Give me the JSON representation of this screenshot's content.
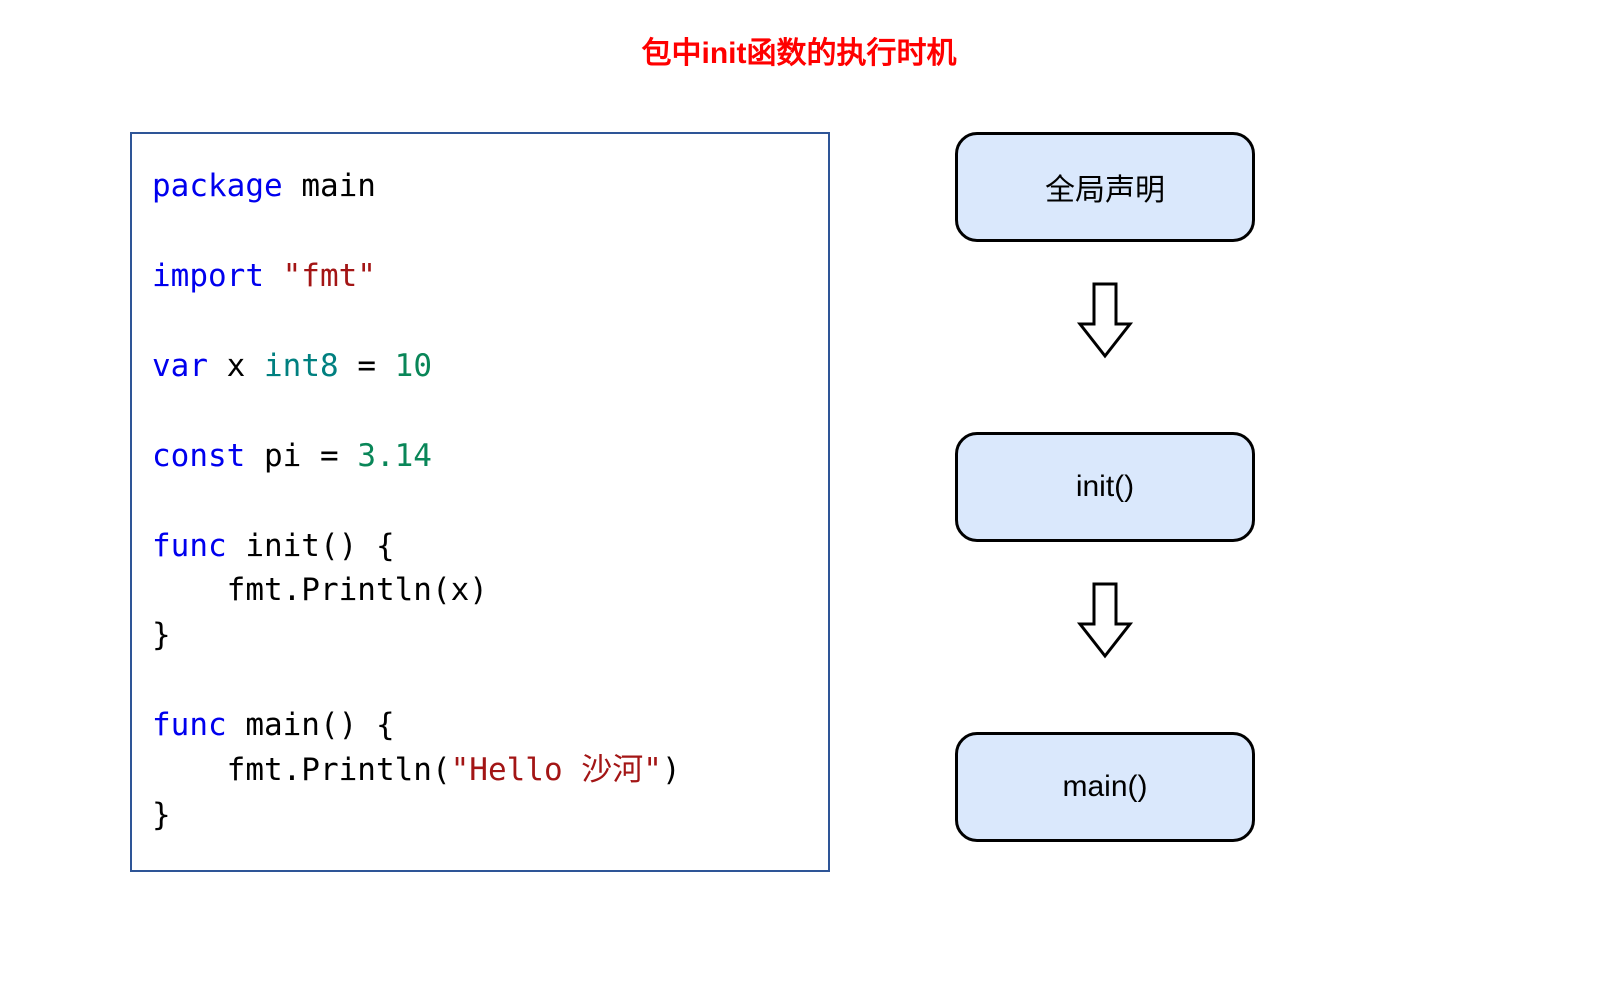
{
  "title": "包中init函数的执行时机",
  "code": {
    "kw_package": "package",
    "pkg_name": " main",
    "kw_import": "import",
    "import_str": " \"fmt\"",
    "kw_var": "var",
    "var_name": " x ",
    "var_type": "int8",
    "var_eq": " = ",
    "var_val": "10",
    "kw_const": "const",
    "const_name": " pi = ",
    "const_val": "3.14",
    "kw_func1": "func",
    "func1_sig": " init() {",
    "func1_body": "    fmt.Println(x)",
    "func1_close": "}",
    "kw_func2": "func",
    "func2_sig": " main() {",
    "func2_call": "    fmt.Println(",
    "func2_str": "\"Hello 沙河\"",
    "func2_paren": ")",
    "func2_close": "}"
  },
  "flow": {
    "step1": "全局声明",
    "step2": "init()",
    "step3": "main()"
  }
}
